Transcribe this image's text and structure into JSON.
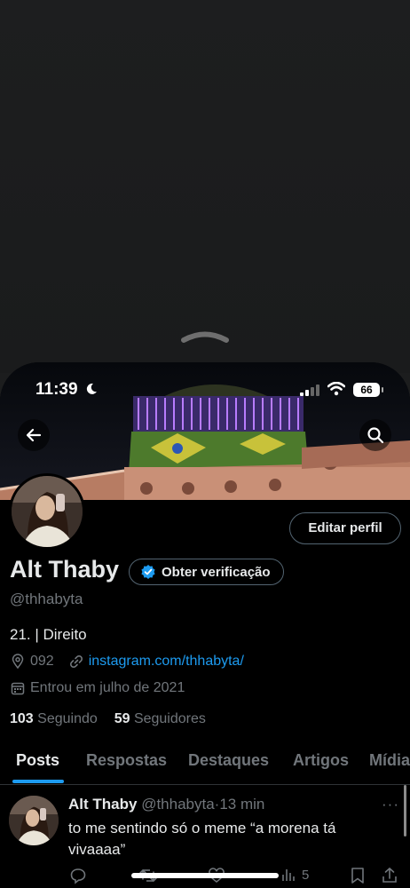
{
  "status": {
    "time": "11:39",
    "battery": "66"
  },
  "icons": {
    "back": "arrow-left-icon",
    "search": "search-icon",
    "verified": "verified-badge-icon",
    "location": "location-pin-icon",
    "link": "link-icon",
    "calendar": "calendar-icon"
  },
  "profile": {
    "name": "Alt Thaby",
    "handle": "@thhabyta",
    "verify_label": "Obter verificação",
    "edit_label": "Editar perfil",
    "bio": "21. | Direito",
    "location": "092",
    "website": "instagram.com/thhabyta/",
    "joined": "Entrou em julho de 2021",
    "following_count": "103",
    "following_label": "Seguindo",
    "followers_count": "59",
    "followers_label": "Seguidores"
  },
  "tabs": [
    {
      "label": "Posts",
      "active": true
    },
    {
      "label": "Respostas",
      "active": false
    },
    {
      "label": "Destaques",
      "active": false
    },
    {
      "label": "Artigos",
      "active": false
    },
    {
      "label": "Mídia",
      "active": false
    }
  ],
  "post": {
    "name": "Alt Thaby",
    "handle": "@thhabyta",
    "separator": "·",
    "time": "13 min",
    "text": "to me sentindo só o meme “a morena tá vivaaaa”",
    "more": "···",
    "views": "5"
  },
  "colors": {
    "accent": "#1d9bf0",
    "background": "#000000",
    "muted": "#71767b",
    "text": "#e7e9ea"
  }
}
